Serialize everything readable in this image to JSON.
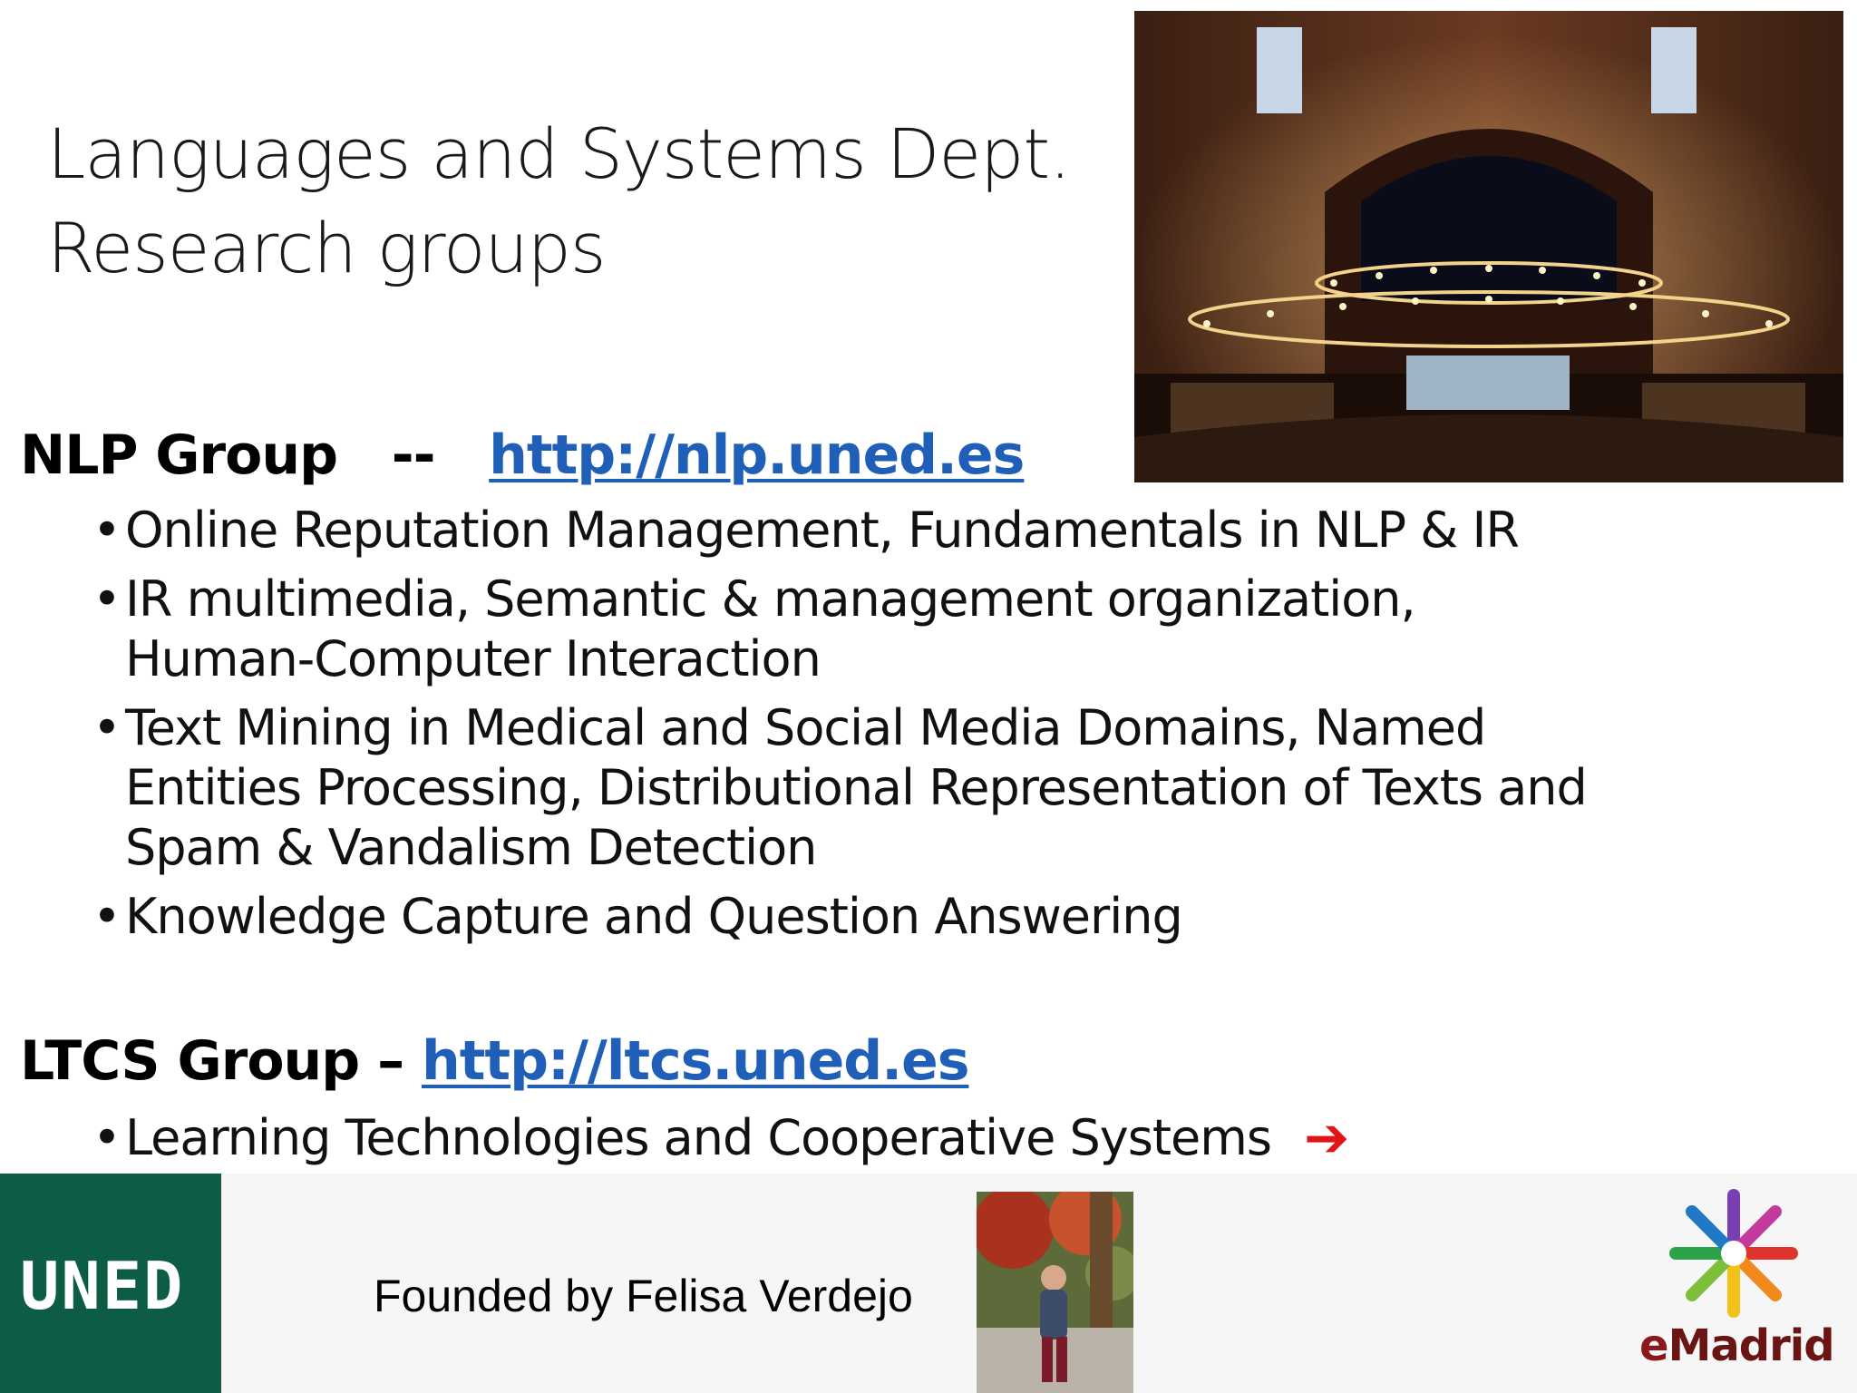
{
  "title": {
    "line1": "Languages and Systems Dept.",
    "line2": "Research groups"
  },
  "nlp_group": {
    "name": "NLP Group   --   ",
    "link": "http://nlp.uned.es",
    "bullets": [
      "Online Reputation Management, Fundamentals in NLP & IR",
      "IR multimedia, Semantic & management organization, Human-Computer Interaction",
      "Text Mining in Medical and Social Media Domains, Named Entities Processing, Distributional Representation of Texts and Spam & Vandalism Detection",
      "Knowledge Capture and Question Answering"
    ]
  },
  "ltcs_group": {
    "name": "LTCS Group – ",
    "link": "http://ltcs.uned.es",
    "bullets": [
      "Learning Technologies and Cooperative Systems"
    ]
  },
  "bullet_glyph": "•",
  "arrow_glyph": "➔",
  "footer": {
    "uned_logo_text": "UNED",
    "founded_text": "Founded by Felisa Verdejo",
    "emadrid_e": "e",
    "emadrid_rest": "Madrid"
  },
  "colors": {
    "link": "#1f5fb8",
    "arrow": "#e0151a",
    "uned_green": "#0d5c45"
  }
}
